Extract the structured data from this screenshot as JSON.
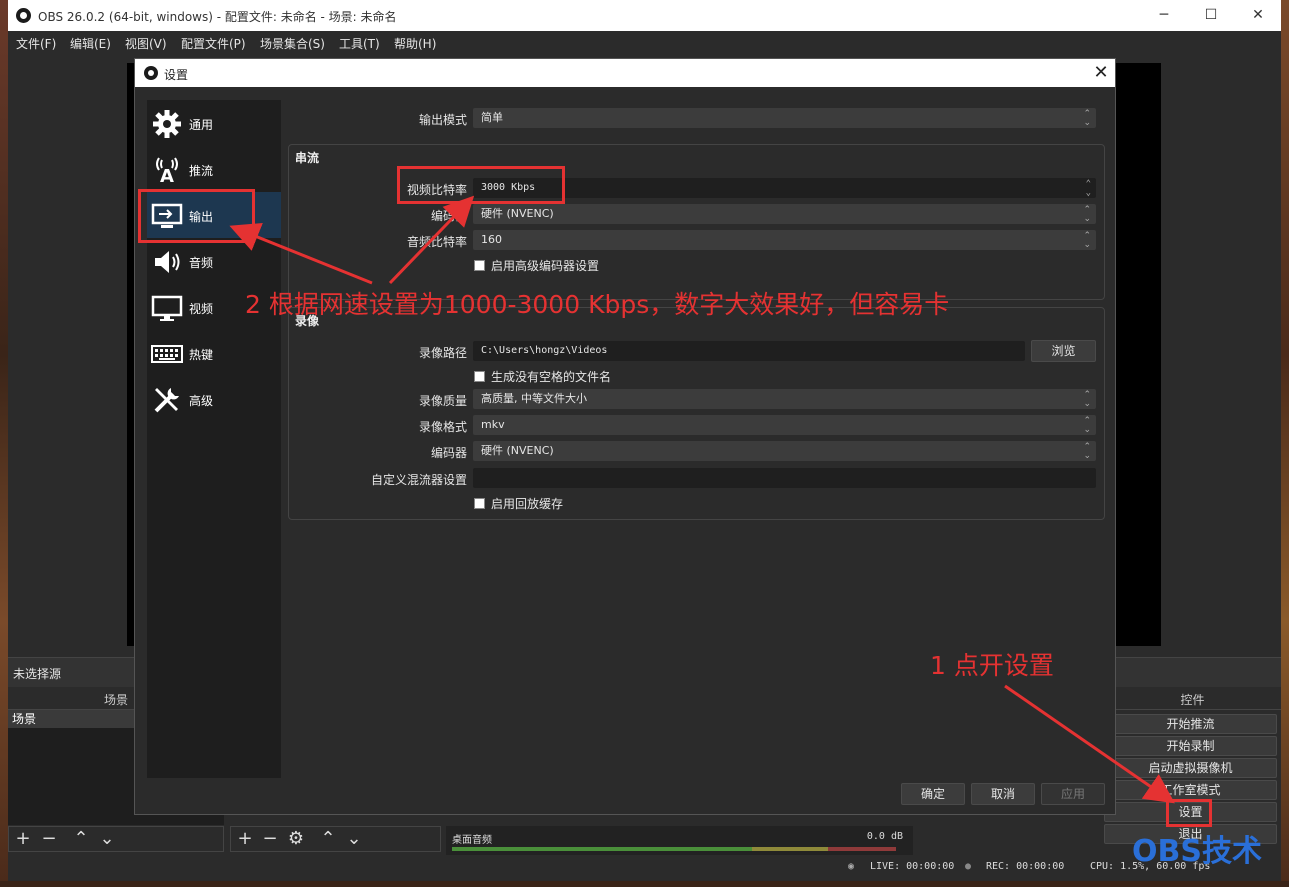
{
  "window": {
    "title": "OBS 26.0.2 (64-bit, windows) - 配置文件: 未命名 - 场景: 未命名",
    "minimize": "─",
    "maximize": "☐",
    "close": "✕"
  },
  "menu": [
    "文件(F)",
    "编辑(E)",
    "视图(V)",
    "配置文件(P)",
    "场景集合(S)",
    "工具(T)",
    "帮助(H)"
  ],
  "source_bar": "未选择源",
  "scenes": {
    "header": "场景",
    "items": [
      "场景"
    ]
  },
  "controls": {
    "header": "控件",
    "buttons": [
      "开始推流",
      "开始录制",
      "启动虚拟摄像机",
      "工作室模式",
      "设置",
      "退出"
    ]
  },
  "mixer": {
    "track": "桌面音频",
    "db": "0.0 dB"
  },
  "status": {
    "live": "LIVE: 00:00:00",
    "rec": "REC: 00:00:00",
    "cpu": "CPU: 1.5%, 60.00 fps"
  },
  "dialog": {
    "title": "设置",
    "close": "✕",
    "sidebar": [
      {
        "label": "通用",
        "icon": "gear-icon"
      },
      {
        "label": "推流",
        "icon": "antenna-icon"
      },
      {
        "label": "输出",
        "icon": "monitor-output-icon"
      },
      {
        "label": "音频",
        "icon": "speaker-icon"
      },
      {
        "label": "视频",
        "icon": "monitor-icon"
      },
      {
        "label": "热键",
        "icon": "keyboard-icon"
      },
      {
        "label": "高级",
        "icon": "tools-icon"
      }
    ],
    "active_tab": "输出",
    "output_mode": {
      "label": "输出模式",
      "value": "简单"
    },
    "streaming": {
      "title": "串流",
      "video_bitrate": {
        "label": "视频比特率",
        "value": "3000 Kbps"
      },
      "encoder": {
        "label": "编码器",
        "value": "硬件 (NVENC)"
      },
      "audio_bitrate": {
        "label": "音频比特率",
        "value": "160"
      },
      "advanced_encoder": "启用高级编码器设置"
    },
    "recording": {
      "title": "录像",
      "path": {
        "label": "录像路径",
        "value": "C:\\Users\\hongz\\Videos",
        "browse": "浏览"
      },
      "no_space": "生成没有空格的文件名",
      "quality": {
        "label": "录像质量",
        "value": "高质量, 中等文件大小"
      },
      "format": {
        "label": "录像格式",
        "value": "mkv"
      },
      "encoder": {
        "label": "编码器",
        "value": "硬件 (NVENC)"
      },
      "muxer": {
        "label": "自定义混流器设置",
        "value": ""
      },
      "replay_buffer": "启用回放缓存"
    },
    "buttons": {
      "ok": "确定",
      "cancel": "取消",
      "apply": "应用"
    }
  },
  "annotations": {
    "step1": "1 点开设置",
    "step2": "2 根据网速设置为1000-3000 Kbps，数字大效果好，但容易卡",
    "color": "#e53232"
  },
  "watermark": "OBS技术"
}
